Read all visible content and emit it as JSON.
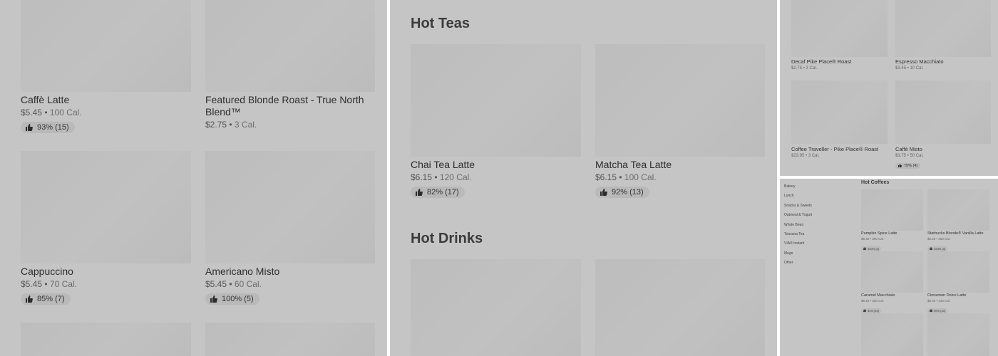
{
  "panel1": {
    "items": [
      {
        "name": "Caffè Latte",
        "price": "$5.45",
        "sep": "•",
        "cal": "100 Cal.",
        "rating": "93% (15)"
      },
      {
        "name": "Featured Blonde Roast - True North Blend™",
        "price": "$2.75",
        "sep": "•",
        "cal": "3 Cal."
      },
      {
        "name": "Cappuccino",
        "price": "$5.45",
        "sep": "•",
        "cal": "70 Cal.",
        "rating": "85% (7)"
      },
      {
        "name": "Americano Misto",
        "price": "$5.45",
        "sep": "•",
        "cal": "60 Cal.",
        "rating": "100% (5)"
      }
    ]
  },
  "panel2": {
    "section1": "Hot Teas",
    "section2": "Hot Drinks",
    "items": [
      {
        "name": "Chai Tea Latte",
        "price": "$6.15",
        "sep": "•",
        "cal": "120 Cal.",
        "rating": "82% (17)"
      },
      {
        "name": "Matcha Tea Latte",
        "price": "$6.15",
        "sep": "•",
        "cal": "100 Cal.",
        "rating": "92% (13)"
      }
    ]
  },
  "panel3": {
    "items": [
      {
        "name": "Decaf Pike Place® Roast",
        "price": "$2.75",
        "sep": "•",
        "cal": "3 Cal."
      },
      {
        "name": "Espresso Macchiato",
        "price": "$3.45",
        "sep": "•",
        "cal": "10 Cal."
      },
      {
        "name": "Coffee Traveller - Pike Place® Roast",
        "price": "$23.95",
        "sep": "•",
        "cal": "3 Cal."
      },
      {
        "name": "Caffè Misto",
        "price": "$3.75",
        "sep": "•",
        "cal": "50 Cal.",
        "rating": "75% (4)"
      }
    ]
  },
  "panel4": {
    "categories": [
      "Bakery",
      "Lunch",
      "Snacks & Sweets",
      "Oatmeal & Yogurt",
      "Whole Bean",
      "Teavana Tea",
      "VIA® Instant",
      "Mugs",
      "Other"
    ],
    "heading": "Hot Coffees",
    "items": [
      {
        "name": "Pumpkin Spice Latte",
        "price": "$6.45",
        "sep": "•",
        "cal": "390 Cal.",
        "rating": "100% (2)"
      },
      {
        "name": "Starbucks Blonde® Vanilla Latte",
        "price": "$6.25",
        "sep": "•",
        "cal": "250 Cal.",
        "rating": "100% (3)"
      },
      {
        "name": "Caramel Macchiato",
        "price": "$6.15",
        "sep": "•",
        "cal": "250 Cal.",
        "rating": "90% (10)"
      },
      {
        "name": "Cinnamon Dolce Latte",
        "price": "$6.45",
        "sep": "•",
        "cal": "340 Cal.",
        "rating": "90% (10)"
      }
    ]
  },
  "icons": {
    "rating": "thumbs-up-icon"
  }
}
